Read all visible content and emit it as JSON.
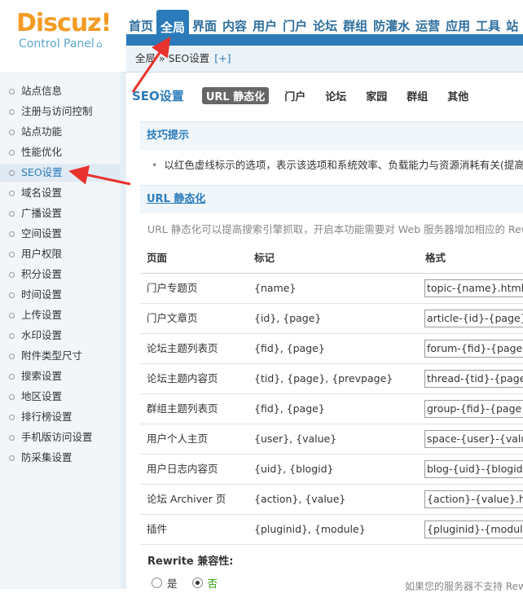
{
  "logo": {
    "text": "Discuz!",
    "subtitle": "Control Panel"
  },
  "topnav": [
    "首页",
    "全局",
    "界面",
    "内容",
    "用户",
    "门户",
    "论坛",
    "群组",
    "防灌水",
    "运营",
    "应用",
    "工具",
    "站"
  ],
  "breadcrumb": {
    "text": "全局 » SEO设置",
    "add": "[+]"
  },
  "sidebar": [
    "站点信息",
    "注册与访问控制",
    "站点功能",
    "性能优化",
    "SEO设置",
    "域名设置",
    "广播设置",
    "空间设置",
    "用户权限",
    "积分设置",
    "时间设置",
    "上传设置",
    "水印设置",
    "附件类型尺寸",
    "搜索设置",
    "地区设置",
    "排行榜设置",
    "手机版访问设置",
    "防采集设置"
  ],
  "main": {
    "title": "SEO设置",
    "tabs": [
      "URL 静态化",
      "门户",
      "论坛",
      "家园",
      "群组",
      "其他"
    ],
    "tip_head": "技巧提示",
    "tip_text": "以红色虚线标示的选项，表示该选项和系统效率、负载能力与资源消耗有关(提高效率",
    "url_head": "URL 静态化",
    "url_desc": "URL 静态化可以提高搜索引擎抓取，开启本功能需要对 Web 服务器增加相应的 Rewrite",
    "table_headers": [
      "页面",
      "标记",
      "格式"
    ],
    "rows": [
      {
        "page": "门户专题页",
        "tags": "{name}",
        "format": "topic-{name}.html"
      },
      {
        "page": "门户文章页",
        "tags": "{id}, {page}",
        "format": "article-{id}-{page}.html"
      },
      {
        "page": "论坛主题列表页",
        "tags": "{fid}, {page}",
        "format": "forum-{fid}-{page}.html"
      },
      {
        "page": "论坛主题内容页",
        "tags": "{tid}, {page}, {prevpage}",
        "format": "thread-{tid}-{page}-{prevpage}.html"
      },
      {
        "page": "群组主题列表页",
        "tags": "{fid}, {page}",
        "format": "group-{fid}-{page}.html"
      },
      {
        "page": "用户个人主页",
        "tags": "{user}, {value}",
        "format": "space-{user}-{value}.html"
      },
      {
        "page": "用户日志内容页",
        "tags": "{uid}, {blogid}",
        "format": "blog-{uid}-{blogid}.html"
      },
      {
        "page": "论坛 Archiver 页",
        "tags": "{action}, {value}",
        "format": "{action}-{value}.html"
      },
      {
        "page": "插件",
        "tags": "{pluginid}, {module}",
        "format": "{pluginid}-{module}.html"
      }
    ],
    "rewrite_label": "Rewrite 兼容性:",
    "opt_yes": "是",
    "opt_no": "否",
    "server_note": "如果您的服务器不支持 Rewrite"
  },
  "colors": {
    "accent": "#2b7bba",
    "logo": "#f39c25",
    "annotation": "#e8322e"
  }
}
